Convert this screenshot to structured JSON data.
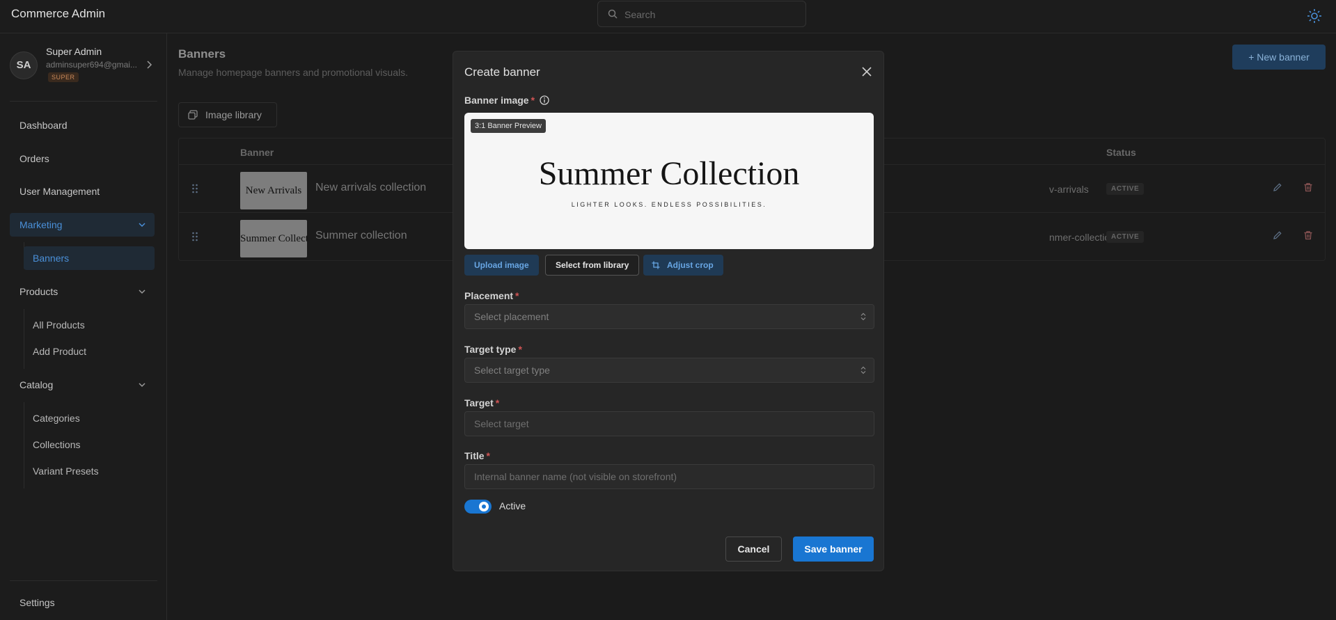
{
  "app": {
    "title": "Commerce Admin"
  },
  "search": {
    "placeholder": "Search"
  },
  "profile": {
    "initials": "SA",
    "name": "Super Admin",
    "email": "adminsuper694@gmai...",
    "role": "SUPER"
  },
  "sidebar": {
    "dashboard": "Dashboard",
    "orders": "Orders",
    "users": "User Management",
    "marketing": "Marketing",
    "banners": "Banners",
    "products": "Products",
    "all_products": "All Products",
    "add_product": "Add Product",
    "catalog": "Catalog",
    "categories": "Categories",
    "collections": "Collections",
    "variant_presets": "Variant Presets",
    "settings": "Settings",
    "active_item": "Banners"
  },
  "page": {
    "title": "Banners",
    "subtitle": "Manage homepage banners and promotional visuals.",
    "new_button": "+ New banner",
    "library_button": "Image library"
  },
  "table": {
    "columns": {
      "banner": "Banner",
      "status": "Status"
    },
    "rows": [
      {
        "thumb_text": "New Arrivals",
        "name": "New arrivals collection",
        "slug": "v-arrivals",
        "status": "ACTIVE"
      },
      {
        "thumb_text": "Summer Collection",
        "name": "Summer collection",
        "slug": "nmer-collection",
        "status": "ACTIVE"
      }
    ]
  },
  "modal": {
    "title": "Create banner",
    "image_label": "Banner image",
    "preview_tag": "3:1 Banner Preview",
    "preview_heading": "Summer Collection",
    "preview_tagline": "LIGHTER LOOKS. ENDLESS POSSIBILITIES.",
    "upload_button": "Upload image",
    "library_button": "Select from library",
    "crop_button": "Adjust crop",
    "placement_label": "Placement",
    "placement_placeholder": "Select placement",
    "target_type_label": "Target type",
    "target_type_placeholder": "Select target type",
    "target_label": "Target",
    "target_placeholder": "Select target",
    "title_label": "Title",
    "title_placeholder": "Internal banner name (not visible on storefront)",
    "active_label": "Active",
    "active": true,
    "cancel_button": "Cancel",
    "save_button": "Save banner"
  },
  "colors": {
    "accent": "#1976d2",
    "background": "#1b1b1b",
    "modal": "#262626",
    "required": "#d05454"
  }
}
